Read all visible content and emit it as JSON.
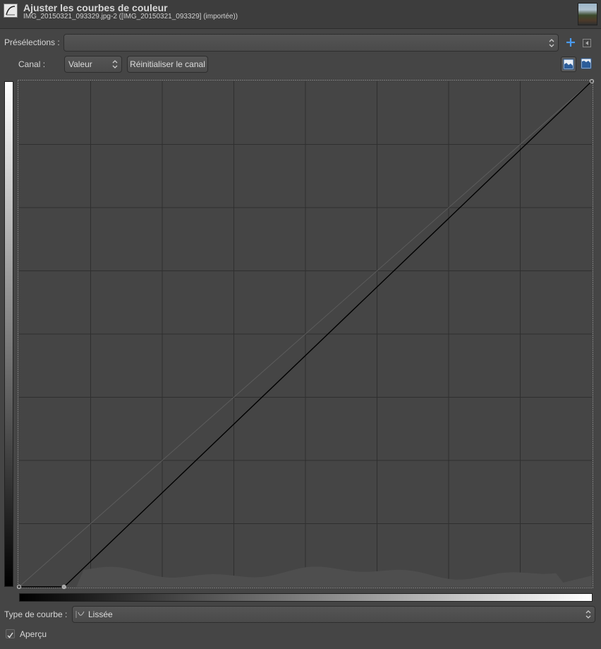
{
  "header": {
    "title": "Ajuster les courbes de couleur",
    "subtitle": "IMG_20150321_093329.jpg-2 ([IMG_20150321_093329] (importée))",
    "tool_icon": "curves-tool-icon",
    "thumbnail": "image-thumbnail"
  },
  "presets": {
    "label": "Présélections :",
    "value": "",
    "add_icon": "plus-icon",
    "menu_icon": "menu-arrow-icon"
  },
  "channel": {
    "label": "Canal :",
    "value": "Valeur",
    "reset_label": "Réinitialiser le canal",
    "linear_histogram_icon": "linear-histogram-icon",
    "log_histogram_icon": "logarithmic-histogram-icon"
  },
  "curve": {
    "input_range": [
      0,
      255
    ],
    "output_range": [
      0,
      255
    ],
    "grid_divisions": 8,
    "points": [
      [
        0,
        0
      ],
      [
        20,
        0
      ],
      [
        255,
        255
      ]
    ],
    "colors": {
      "background": "#454545",
      "grid": "#2f2f2f",
      "curve": "#000000",
      "histogram": "#4e4e4e",
      "identity": "#5c5c5c"
    }
  },
  "curve_type": {
    "label": "Type de courbe :",
    "value": "Lissée",
    "icon": "smooth-curve-icon"
  },
  "preview": {
    "label": "Aperçu",
    "checked": true
  }
}
